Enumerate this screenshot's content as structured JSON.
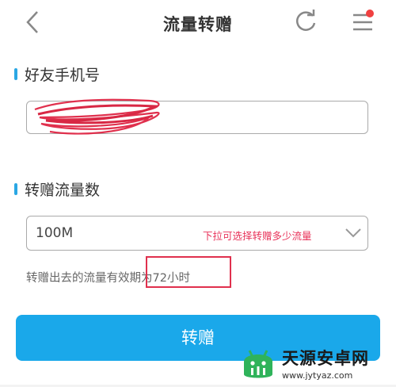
{
  "header": {
    "title": "流量转赠",
    "icons": {
      "back": "chevron-left-icon",
      "refresh": "refresh-icon",
      "menu": "hamburger-menu-icon"
    },
    "notification_dot_color": "#f04040"
  },
  "friend_phone": {
    "label": "好友手机号",
    "value_redacted": true
  },
  "transfer_amount": {
    "label": "转赠流量数",
    "selected": "100M",
    "hint": "下拉可选择转赠多少流量",
    "dropdown_icon": "chevron-down-icon"
  },
  "validity_note": {
    "prefix": "转赠出去的流量有效期",
    "highlight": "为72小时"
  },
  "submit": {
    "label": "转赠"
  },
  "watermark": {
    "name": "天源安卓网",
    "url": "www.jytyaz.com"
  },
  "colors": {
    "accent": "#2aa7e4",
    "button": "#1aa8ea",
    "annotation": "#e0304d"
  }
}
